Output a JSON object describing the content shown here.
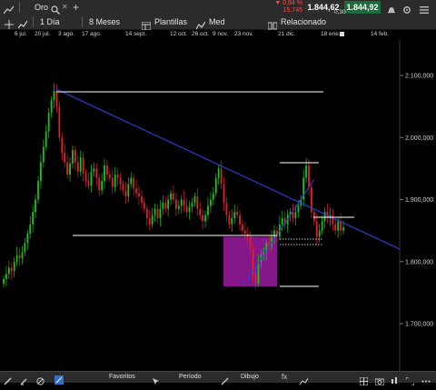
{
  "window": {
    "instrument": "Oro",
    "change_pct": "▼ 0,84 %",
    "change_abs": "15,745",
    "spread": "0,30",
    "bid": "1.844,62",
    "ask": "1.844,92"
  },
  "toolbar": {
    "interval": "1 Día",
    "range": "8 Meses",
    "templates": "Plantillas",
    "indicator": "Med",
    "related": "Relacionado"
  },
  "date_axis": [
    "6 jul.",
    "20 jul.",
    "3 ago.",
    "17 ago.",
    "14 sept.",
    "12 oct.",
    "26 oct.",
    "9 nov.",
    "23 nov.",
    "21 dic.",
    "18 ene.",
    "14 feb."
  ],
  "price_axis": [
    "2.100,000",
    "2.000,000",
    "1.900,000",
    "1.800,000",
    "1.700,000"
  ],
  "bottom": {
    "favorites": "Favoritos",
    "period": "Período",
    "drawing": "Dibujo"
  },
  "colors": {
    "up": "#19c419",
    "down": "#e0202a",
    "trendline": "#2b3fd9",
    "highlight": "#b21fb8",
    "ask_bg": "#1c6b3a",
    "bid_bg": "#2e2e2e"
  },
  "chart_data": {
    "type": "candlestick",
    "y_range": [
      1650,
      2150
    ],
    "ticks": [
      2100,
      2000,
      1900,
      1800,
      1700
    ],
    "closes": [
      1772,
      1780,
      1790,
      1785,
      1800,
      1810,
      1805,
      1815,
      1830,
      1845,
      1860,
      1880,
      1900,
      1930,
      1960,
      1985,
      2010,
      2040,
      2060,
      2075,
      2050,
      2000,
      1975,
      1960,
      1940,
      1958,
      1980,
      1960,
      1945,
      1968,
      1942,
      1930,
      1922,
      1945,
      1950,
      1935,
      1915,
      1930,
      1955,
      1940,
      1935,
      1920,
      1940,
      1935,
      1925,
      1915,
      1905,
      1925,
      1935,
      1918,
      1910,
      1905,
      1895,
      1885,
      1870,
      1860,
      1875,
      1885,
      1870,
      1885,
      1895,
      1885,
      1900,
      1910,
      1900,
      1885,
      1890,
      1900,
      1890,
      1880,
      1888,
      1895,
      1905,
      1885,
      1875,
      1865,
      1875,
      1890,
      1900,
      1910,
      1935,
      1950,
      1925,
      1895,
      1875,
      1860,
      1870,
      1880,
      1875,
      1860,
      1850,
      1845,
      1840,
      1820,
      1780,
      1765,
      1800,
      1810,
      1815,
      1830,
      1825,
      1840,
      1850,
      1840,
      1860,
      1870,
      1860,
      1875,
      1880,
      1870,
      1880,
      1890,
      1900,
      1935,
      1955,
      1920,
      1880,
      1865,
      1840,
      1850,
      1865,
      1880,
      1870,
      1875,
      1860,
      1850,
      1865,
      1850,
      1855
    ],
    "support_line": 1845,
    "resistance_line": 2072
  }
}
